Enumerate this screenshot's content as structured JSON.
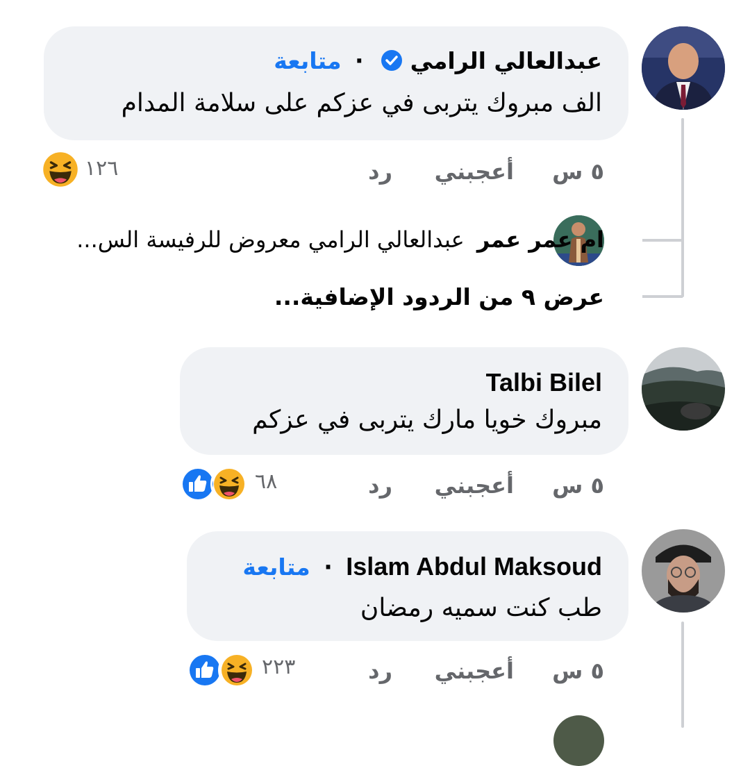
{
  "colors": {
    "bubble": "#f0f2f5",
    "accent": "#1877f2",
    "meta": "#65676b",
    "thread": "#ced0d4",
    "haha": "#f7b125",
    "like": "#1877f2"
  },
  "comments": [
    {
      "author": "عبدالعالي الرامي",
      "verified_icon": "verified-badge-icon",
      "separator": "·",
      "follow": "متابعة",
      "text": "الف مبروك يتربى في عزكم على سلامة المدام",
      "time": "٥ س",
      "like": "أعجبني",
      "reply": "رد",
      "reactions": [
        "haha-icon"
      ],
      "reaction_count": "١٢٦",
      "reply_preview": {
        "author": "ام عمر عمر",
        "text": "عبدالعالي الرامي معروض للرفيسة الس..."
      },
      "more_replies": "عرض ٩ من الردود الإضافية..."
    },
    {
      "author": "Talbi Bilel",
      "text": "مبروك خويا مارك يتربى في عزكم",
      "time": "٥ س",
      "like": "أعجبني",
      "reply": "رد",
      "reactions": [
        "like-icon",
        "haha-icon"
      ],
      "reaction_count": "٦٨"
    },
    {
      "author": "Islam Abdul Maksoud",
      "separator": "·",
      "follow": "متابعة",
      "text": "طب كنت سميه رمضان",
      "time": "٥ س",
      "like": "أعجبني",
      "reply": "رد",
      "reactions": [
        "like-icon",
        "haha-icon"
      ],
      "reaction_count": "٢٢٣"
    }
  ]
}
